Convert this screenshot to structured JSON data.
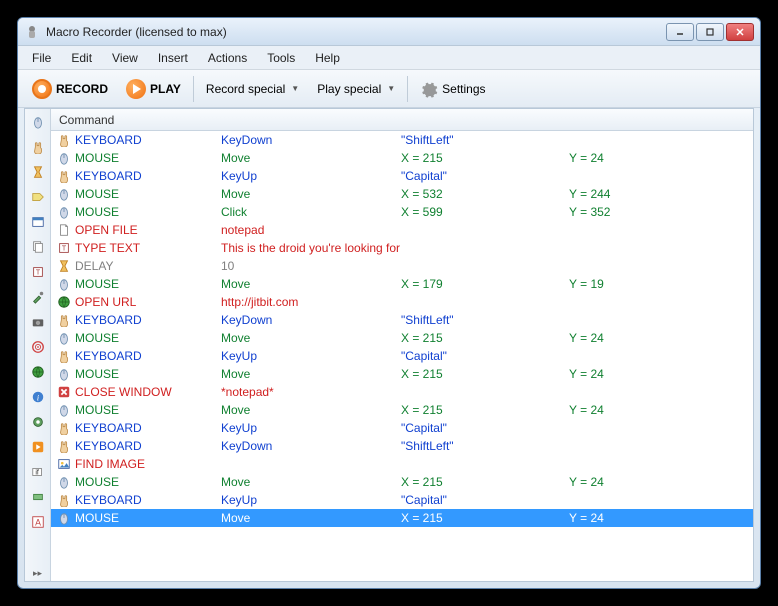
{
  "window": {
    "title": "Macro Recorder (licensed to max)"
  },
  "menubar": [
    "File",
    "Edit",
    "View",
    "Insert",
    "Actions",
    "Tools",
    "Help"
  ],
  "toolbar": {
    "record": "RECORD",
    "play": "PLAY",
    "record_special": "Record special",
    "play_special": "Play special",
    "settings": "Settings"
  },
  "grid": {
    "header": "Command"
  },
  "rows": [
    {
      "type": "kb",
      "icon": "hand",
      "cmd": "KEYBOARD",
      "p1": "KeyDown",
      "p2": "\"ShiftLeft\"",
      "p3": ""
    },
    {
      "type": "ms",
      "icon": "mouse",
      "cmd": "MOUSE",
      "p1": "Move",
      "p2": "X = 215",
      "p3": "Y = 24"
    },
    {
      "type": "kb",
      "icon": "hand",
      "cmd": "KEYBOARD",
      "p1": "KeyUp",
      "p2": "\"Capital\"",
      "p3": ""
    },
    {
      "type": "ms",
      "icon": "mouse",
      "cmd": "MOUSE",
      "p1": "Move",
      "p2": "X = 532",
      "p3": "Y = 244"
    },
    {
      "type": "ms",
      "icon": "mouse",
      "cmd": "MOUSE",
      "p1": "Click",
      "p2": "X = 599",
      "p3": "Y = 352"
    },
    {
      "type": "fl",
      "icon": "file",
      "cmd": "OPEN FILE",
      "p1": "notepad",
      "p2": "",
      "p3": ""
    },
    {
      "type": "fl",
      "icon": "text",
      "cmd": "TYPE TEXT",
      "p1": "This is the droid you're looking for!",
      "p2": "",
      "p3": ""
    },
    {
      "type": "dl",
      "icon": "timer",
      "cmd": "DELAY",
      "p1": "10",
      "p2": "",
      "p3": ""
    },
    {
      "type": "ms",
      "icon": "mouse",
      "cmd": "MOUSE",
      "p1": "Move",
      "p2": "X = 179",
      "p3": "Y = 19"
    },
    {
      "type": "fl",
      "icon": "globe",
      "cmd": "OPEN URL",
      "p1": "http://jitbit.com",
      "p2": "",
      "p3": ""
    },
    {
      "type": "kb",
      "icon": "hand",
      "cmd": "KEYBOARD",
      "p1": "KeyDown",
      "p2": "\"ShiftLeft\"",
      "p3": ""
    },
    {
      "type": "ms",
      "icon": "mouse",
      "cmd": "MOUSE",
      "p1": "Move",
      "p2": "X = 215",
      "p3": "Y = 24"
    },
    {
      "type": "kb",
      "icon": "hand",
      "cmd": "KEYBOARD",
      "p1": "KeyUp",
      "p2": "\"Capital\"",
      "p3": ""
    },
    {
      "type": "ms",
      "icon": "mouse",
      "cmd": "MOUSE",
      "p1": "Move",
      "p2": "X = 215",
      "p3": "Y = 24"
    },
    {
      "type": "fl",
      "icon": "close",
      "cmd": "CLOSE WINDOW",
      "p1": "*notepad*",
      "p2": "",
      "p3": ""
    },
    {
      "type": "ms",
      "icon": "mouse",
      "cmd": "MOUSE",
      "p1": "Move",
      "p2": "X = 215",
      "p3": "Y = 24"
    },
    {
      "type": "kb",
      "icon": "hand",
      "cmd": "KEYBOARD",
      "p1": "KeyUp",
      "p2": "\"Capital\"",
      "p3": ""
    },
    {
      "type": "kb",
      "icon": "hand",
      "cmd": "KEYBOARD",
      "p1": "KeyDown",
      "p2": "\"ShiftLeft\"",
      "p3": ""
    },
    {
      "type": "fl",
      "icon": "image",
      "cmd": "FIND IMAGE",
      "p1": "",
      "p2": "",
      "p3": ""
    },
    {
      "type": "ms",
      "icon": "mouse",
      "cmd": "MOUSE",
      "p1": "Move",
      "p2": "X = 215",
      "p3": "Y = 24"
    },
    {
      "type": "kb",
      "icon": "hand",
      "cmd": "KEYBOARD",
      "p1": "KeyUp",
      "p2": "\"Capital\"",
      "p3": ""
    },
    {
      "type": "ms",
      "icon": "mouse",
      "cmd": "MOUSE",
      "p1": "Move",
      "p2": "X = 215",
      "p3": "Y = 24",
      "selected": true
    }
  ],
  "sidebar_icons": [
    "mouse",
    "hand",
    "timer",
    "label",
    "window",
    "copy",
    "text",
    "picker",
    "camera",
    "target",
    "globe",
    "info",
    "gear",
    "play",
    "if",
    "shape",
    "letter"
  ]
}
